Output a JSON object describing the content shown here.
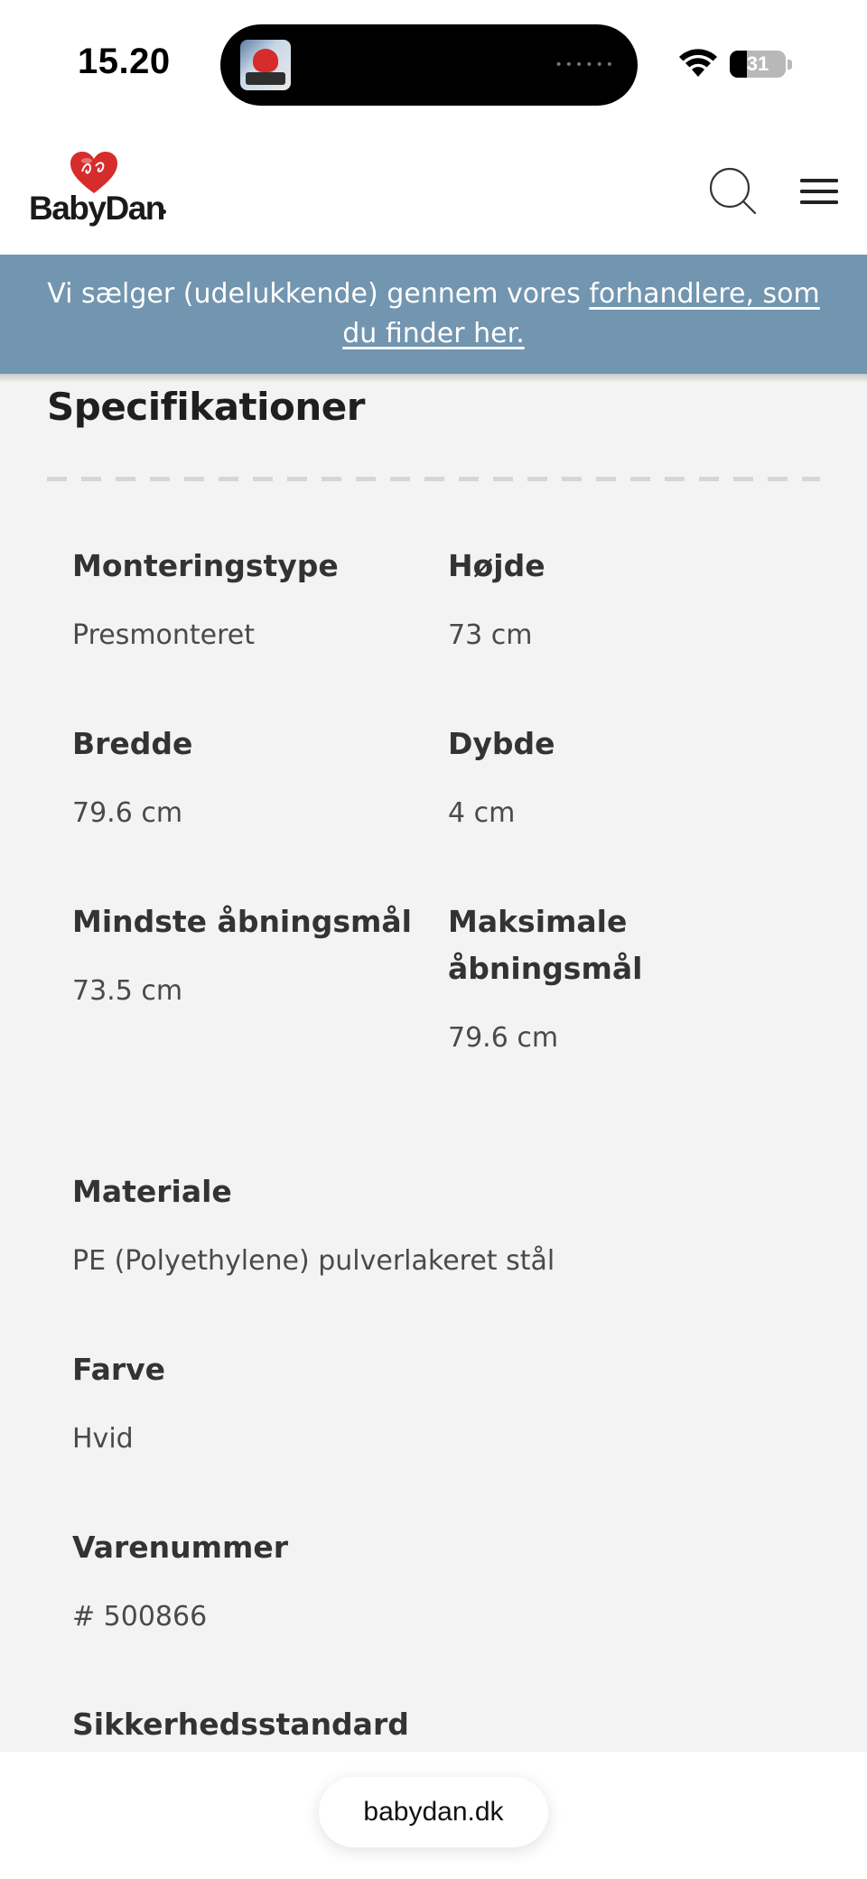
{
  "status_bar": {
    "time": "15.20",
    "battery": "31"
  },
  "header": {
    "logo_text": "BabyDan"
  },
  "notice": {
    "text": "Vi sælger (udelukkende) gennem vores ",
    "link": "forhandlere, som du finder her."
  },
  "specs": {
    "title": "Specifikationer",
    "items": [
      {
        "label": "Monteringstype",
        "value": "Presmonteret"
      },
      {
        "label": "Højde",
        "value": "73 cm"
      },
      {
        "label": "Bredde",
        "value": "79.6 cm"
      },
      {
        "label": "Dybde",
        "value": "4 cm"
      },
      {
        "label": "Mindste åbningsmål",
        "value": "73.5 cm"
      },
      {
        "label": "Maksimale åbningsmål",
        "value": "79.6 cm"
      },
      {
        "label": "Materiale",
        "value": "PE (Polyethylene) pulverlakeret stål"
      },
      {
        "label": "Farve",
        "value": "Hvid"
      },
      {
        "label": "Varenummer",
        "value": "# 500866"
      },
      {
        "label": "Sikkerhedsstandard",
        "value": ""
      }
    ]
  },
  "browser": {
    "url": "babydan.dk"
  },
  "icons": {
    "search": "search-icon",
    "menu": "hamburger-menu-icon",
    "wifi": "wifi-icon",
    "battery": "battery-icon"
  },
  "colors": {
    "banner": "#7295b0",
    "logo_heart": "#d62c2c"
  }
}
